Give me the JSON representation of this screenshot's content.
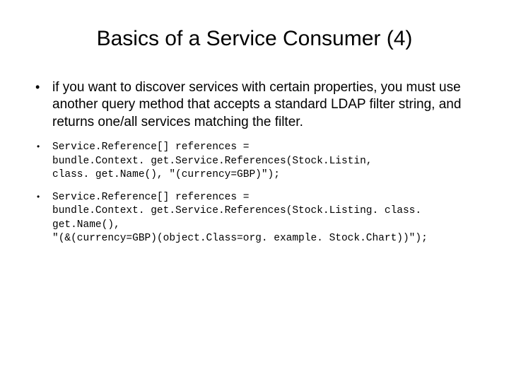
{
  "title": "Basics of a Service Consumer (4)",
  "bullets": {
    "intro": "if you want to discover services with certain properties, you must use another query method that accepts a standard LDAP filter string, and returns one/all services matching the filter",
    "code1": "Service.Reference[] references =\nbundle.Context. get.Service.References(Stock.Listin,\nclass. get.Name(), \"(currency=GBP)\");",
    "code2": "Service.Reference[] references =\nbundle.Context. get.Service.References(Stock.Listing. class. get.Name(),\n\"(&(currency=GBP)(object.Class=org. example. Stock.Chart))\");"
  }
}
